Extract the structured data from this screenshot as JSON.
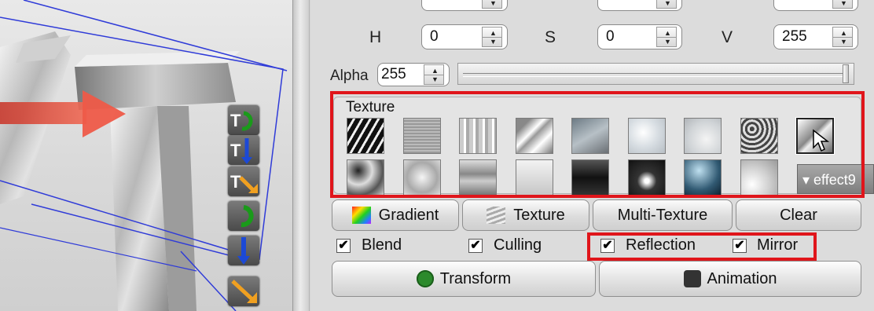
{
  "colors": {
    "highlight": "#e0151b",
    "panel": "#dcdcdc"
  },
  "color_controls": {
    "row_top": {
      "labels": [
        "",
        "",
        ""
      ]
    },
    "hsv": [
      {
        "label": "H",
        "value": "0"
      },
      {
        "label": "S",
        "value": "0"
      },
      {
        "label": "V",
        "value": "255"
      }
    ],
    "alpha": {
      "label": "Alpha",
      "value": "255",
      "slider_fraction": 1.0
    }
  },
  "texture_panel": {
    "title": "Texture",
    "row1": [
      "texture-1",
      "texture-2",
      "texture-3",
      "texture-4",
      "texture-5",
      "texture-6",
      "texture-7",
      "texture-8",
      "texture-9"
    ],
    "row2": [
      "texture-10",
      "texture-11",
      "texture-12",
      "texture-13",
      "texture-14",
      "texture-15",
      "texture-16",
      "texture-17"
    ],
    "selected_index": 8,
    "effect_button": "▾ effect9"
  },
  "fill_buttons": {
    "gradient": "Gradient",
    "texture": "Texture",
    "multi_texture": "Multi-Texture",
    "clear": "Clear"
  },
  "options": [
    {
      "label": "Blend",
      "checked": true
    },
    {
      "label": "Culling",
      "checked": true
    },
    {
      "label": "Reflection",
      "checked": true
    },
    {
      "label": "Mirror",
      "checked": true
    }
  ],
  "bottom_buttons": {
    "transform": "Transform",
    "animation": "Animation"
  },
  "gizmo_icons": [
    "rotate-icon",
    "move-y-icon",
    "move-xy-icon",
    "rotate-icon",
    "move-y-icon",
    "scale-icon"
  ]
}
